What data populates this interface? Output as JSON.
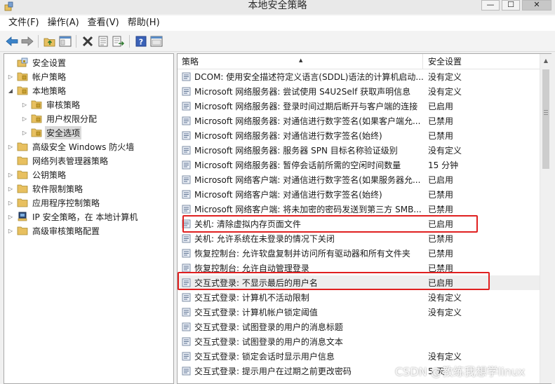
{
  "window": {
    "title": "本地安全策略",
    "min_label": "—",
    "max_label": "☐",
    "close_label": "✕"
  },
  "menu": [
    "文件(F)",
    "操作(A)",
    "查看(V)",
    "帮助(H)"
  ],
  "toolbar": [
    "back-icon",
    "forward-icon",
    "up-folder-icon",
    "show-tree-icon",
    "delete-icon",
    "properties-icon",
    "export-icon",
    "help-icon",
    "console-icon"
  ],
  "tree": [
    {
      "label": "安全设置",
      "level": 0,
      "expander": "",
      "icon": "security-settings-icon"
    },
    {
      "label": "帐户策略",
      "level": 1,
      "expander": "collapsed",
      "icon": "folder-icon"
    },
    {
      "label": "本地策略",
      "level": 1,
      "expander": "expanded",
      "icon": "folder-icon"
    },
    {
      "label": "审核策略",
      "level": 2,
      "expander": "collapsed",
      "icon": "folder-icon"
    },
    {
      "label": "用户权限分配",
      "level": 2,
      "expander": "collapsed",
      "icon": "folder-icon"
    },
    {
      "label": "安全选项",
      "level": 2,
      "expander": "collapsed",
      "icon": "folder-icon",
      "selected": true
    },
    {
      "label": "高级安全 Windows 防火墙",
      "level": 1,
      "expander": "collapsed",
      "icon": "folder-icon"
    },
    {
      "label": "网络列表管理器策略",
      "level": 1,
      "expander": "",
      "icon": "folder-icon"
    },
    {
      "label": "公钥策略",
      "level": 1,
      "expander": "collapsed",
      "icon": "folder-icon"
    },
    {
      "label": "软件限制策略",
      "level": 1,
      "expander": "collapsed",
      "icon": "folder-icon"
    },
    {
      "label": "应用程序控制策略",
      "level": 1,
      "expander": "collapsed",
      "icon": "folder-icon"
    },
    {
      "label": "IP 安全策略，在 本地计算机",
      "level": 1,
      "expander": "collapsed",
      "icon": "ip-security-icon"
    },
    {
      "label": "高级审核策略配置",
      "level": 1,
      "expander": "collapsed",
      "icon": "folder-icon"
    }
  ],
  "list": {
    "columns": [
      "策略",
      "安全设置"
    ],
    "rows": [
      {
        "name": "DCOM: 使用安全描述符定义语言(SDDL)语法的计算机启动...",
        "value": "没有定义"
      },
      {
        "name": "Microsoft 网络服务器: 尝试使用 S4U2Self 获取声明信息",
        "value": "没有定义"
      },
      {
        "name": "Microsoft 网络服务器: 登录时间过期后断开与客户端的连接",
        "value": "已启用"
      },
      {
        "name": "Microsoft 网络服务器: 对通信进行数字签名(如果客户端允...",
        "value": "已禁用"
      },
      {
        "name": "Microsoft 网络服务器: 对通信进行数字签名(始终)",
        "value": "已禁用"
      },
      {
        "name": "Microsoft 网络服务器: 服务器 SPN 目标名称验证级别",
        "value": "没有定义"
      },
      {
        "name": "Microsoft 网络服务器: 暂停会话前所需的空闲时间数量",
        "value": "15 分钟"
      },
      {
        "name": "Microsoft 网络客户端: 对通信进行数字签名(如果服务器允...",
        "value": "已启用"
      },
      {
        "name": "Microsoft 网络客户端: 对通信进行数字签名(始终)",
        "value": "已禁用"
      },
      {
        "name": "Microsoft 网络客户端: 将未加密的密码发送到第三方 SMB...",
        "value": "已禁用"
      },
      {
        "name": "关机: 清除虚拟内存页面文件",
        "value": "已启用"
      },
      {
        "name": "关机: 允许系统在未登录的情况下关闭",
        "value": "已禁用"
      },
      {
        "name": "恢复控制台: 允许软盘复制并访问所有驱动器和所有文件夹",
        "value": "已禁用"
      },
      {
        "name": "恢复控制台: 允许自动管理登录",
        "value": "已禁用"
      },
      {
        "name": "交互式登录: 不显示最后的用户名",
        "value": "已启用",
        "highlighted": true
      },
      {
        "name": "交互式登录: 计算机不活动限制",
        "value": "没有定义"
      },
      {
        "name": "交互式登录: 计算机帐户锁定阈值",
        "value": "没有定义"
      },
      {
        "name": "交互式登录: 试图登录的用户的消息标题",
        "value": ""
      },
      {
        "name": "交互式登录: 试图登录的用户的消息文本",
        "value": ""
      },
      {
        "name": "交互式登录: 锁定会话时显示用户信息",
        "value": "没有定义"
      },
      {
        "name": "交互式登录: 提示用户在过期之前更改密码",
        "value": "5 天"
      }
    ]
  },
  "colors": {
    "annotation": "#e02020",
    "folder": "#e8c060",
    "selected_row": "#eeeeee"
  },
  "watermark": "CSDN @教练我想学linux"
}
